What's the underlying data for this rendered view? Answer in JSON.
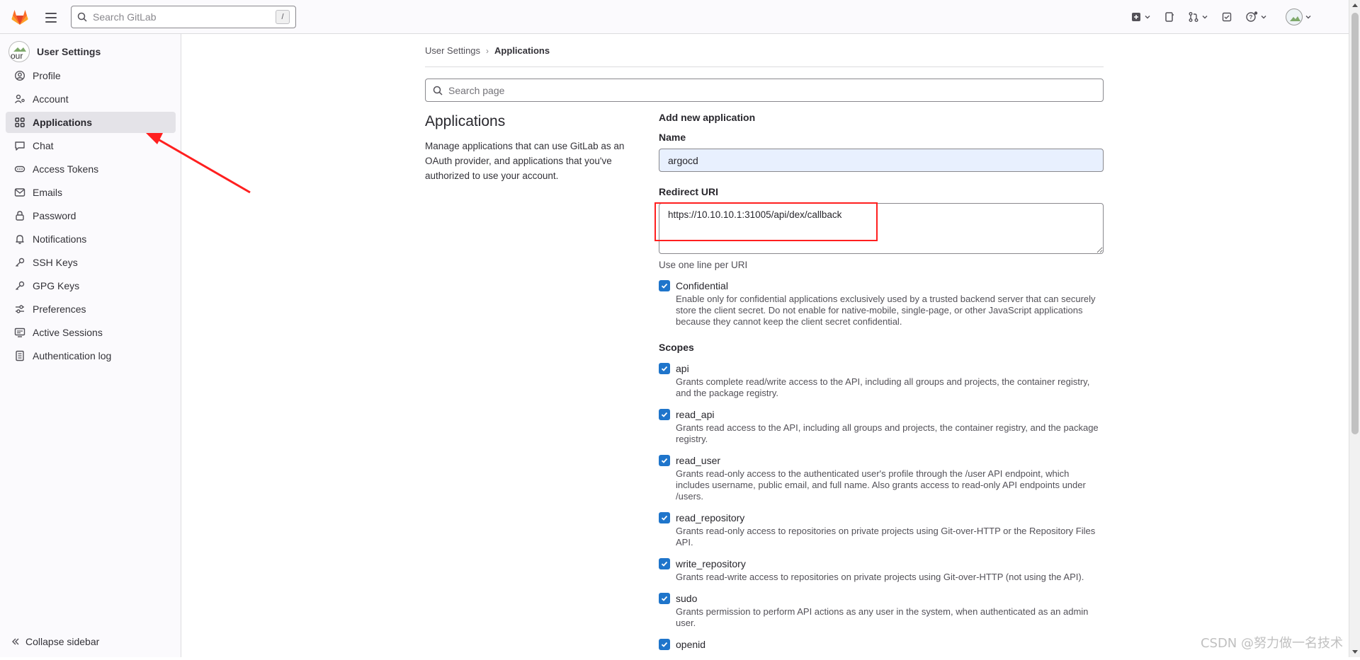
{
  "topbar": {
    "search_placeholder": "Search GitLab",
    "search_shortcut": "/",
    "icons": [
      "plus-square-icon",
      "issues-icon",
      "merge-request-icon",
      "todo-icon",
      "help-icon",
      "user-avatar"
    ]
  },
  "sidebar": {
    "title": "User Settings",
    "avatar_text": "our",
    "items": [
      {
        "label": "Profile",
        "icon": "profile-icon"
      },
      {
        "label": "Account",
        "icon": "account-icon"
      },
      {
        "label": "Applications",
        "icon": "applications-icon",
        "active": true
      },
      {
        "label": "Chat",
        "icon": "chat-icon"
      },
      {
        "label": "Access Tokens",
        "icon": "token-icon"
      },
      {
        "label": "Emails",
        "icon": "email-icon"
      },
      {
        "label": "Password",
        "icon": "lock-icon"
      },
      {
        "label": "Notifications",
        "icon": "bell-icon"
      },
      {
        "label": "SSH Keys",
        "icon": "key-icon"
      },
      {
        "label": "GPG Keys",
        "icon": "key-icon"
      },
      {
        "label": "Preferences",
        "icon": "preferences-icon"
      },
      {
        "label": "Active Sessions",
        "icon": "monitor-icon"
      },
      {
        "label": "Authentication log",
        "icon": "log-icon"
      }
    ],
    "collapse_label": "Collapse sidebar"
  },
  "breadcrumb": {
    "parent": "User Settings",
    "separator": "›",
    "current": "Applications"
  },
  "page_search_placeholder": "Search page",
  "section": {
    "title": "Applications",
    "description": "Manage applications that can use GitLab as an OAuth provider, and applications that you've authorized to use your account."
  },
  "form": {
    "heading": "Add new application",
    "name_label": "Name",
    "name_value": "argocd",
    "redirect_label": "Redirect URI",
    "redirect_value": "https://10.10.10.1:31005/api/dex/callback",
    "redirect_hint": "Use one line per URI",
    "confidential": {
      "label": "Confidential",
      "checked": true,
      "description": "Enable only for confidential applications exclusively used by a trusted backend server that can securely store the client secret. Do not enable for native-mobile, single-page, or other JavaScript applications because they cannot keep the client secret confidential."
    },
    "scopes_heading": "Scopes",
    "scopes": [
      {
        "name": "api",
        "checked": true,
        "description": "Grants complete read/write access to the API, including all groups and projects, the container registry, and the package registry."
      },
      {
        "name": "read_api",
        "checked": true,
        "description": "Grants read access to the API, including all groups and projects, the container registry, and the package registry."
      },
      {
        "name": "read_user",
        "checked": true,
        "description": "Grants read-only access to the authenticated user's profile through the /user API endpoint, which includes username, public email, and full name. Also grants access to read-only API endpoints under /users."
      },
      {
        "name": "read_repository",
        "checked": true,
        "description": "Grants read-only access to repositories on private projects using Git-over-HTTP or the Repository Files API."
      },
      {
        "name": "write_repository",
        "checked": true,
        "description": "Grants read-write access to repositories on private projects using Git-over-HTTP (not using the API)."
      },
      {
        "name": "sudo",
        "checked": true,
        "description": "Grants permission to perform API actions as any user in the system, when authenticated as an admin user."
      },
      {
        "name": "openid",
        "checked": true,
        "description": ""
      }
    ]
  },
  "watermark": "CSDN @努力做一名技术",
  "colors": {
    "accent": "#1f75cb",
    "annotation_red": "#ff1f1f",
    "active_nav_bg": "#e4e3e8"
  }
}
